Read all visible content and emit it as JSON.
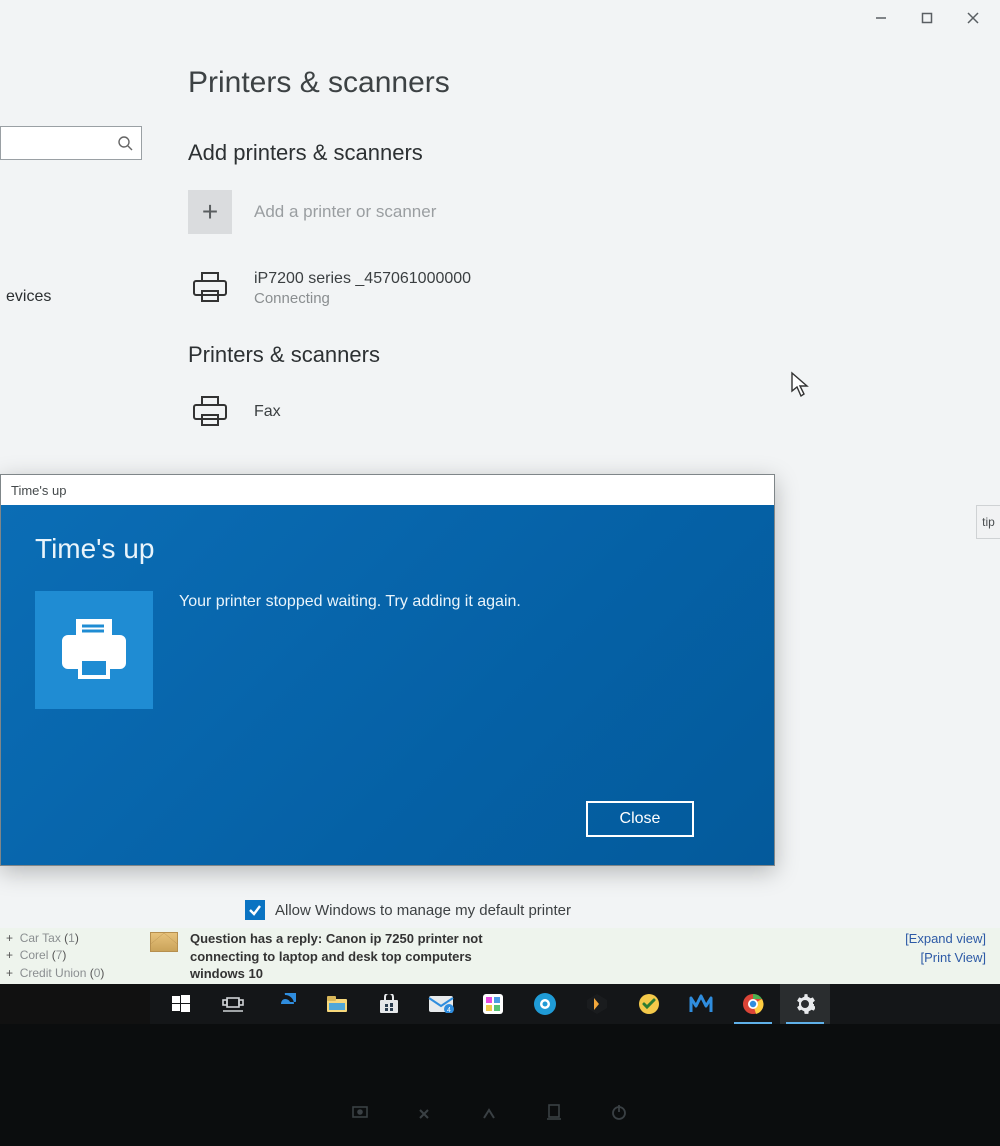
{
  "window": {
    "page_title": "Printers & scanners",
    "section_add": "Add printers & scanners",
    "add_label": "Add a printer or scanner",
    "section_list": "Printers & scanners",
    "sidebar_category": "evices",
    "default_printer_label": "Allow Windows to manage my default printer",
    "right_handle_label": "tip"
  },
  "devices": {
    "pending": {
      "name": "iP7200 series _457061000000",
      "status": "Connecting"
    },
    "list": [
      {
        "name": "Fax"
      }
    ]
  },
  "dialog": {
    "titlebar": "Time's up",
    "heading": "Time's up",
    "message": "Your printer stopped waiting. Try adding it again.",
    "close": "Close"
  },
  "background": {
    "tree": [
      {
        "label": "Car Tax",
        "count": "1"
      },
      {
        "label": "Corel",
        "count": "7"
      },
      {
        "label": "Credit Union",
        "count": "0"
      }
    ],
    "notification": "Question has a reply: Canon ip 7250 printer not connecting to laptop and desk top computers windows 10",
    "links": {
      "expand": "[Expand view]",
      "print": "[Print View]"
    }
  },
  "taskbar": {
    "items": [
      "start-icon",
      "task-view-icon",
      "edge-icon",
      "file-explorer-icon",
      "store-icon",
      "mail-icon",
      "app-icon",
      "camera-icon",
      "plex-icon",
      "antivirus-icon",
      "malwarebytes-icon",
      "chrome-icon",
      "settings-icon"
    ]
  },
  "bezel": {
    "glyphs": [
      "brightness-down-icon",
      "volume-down-icon",
      "volume-up-icon",
      "airplane-icon",
      "power-icon"
    ]
  }
}
